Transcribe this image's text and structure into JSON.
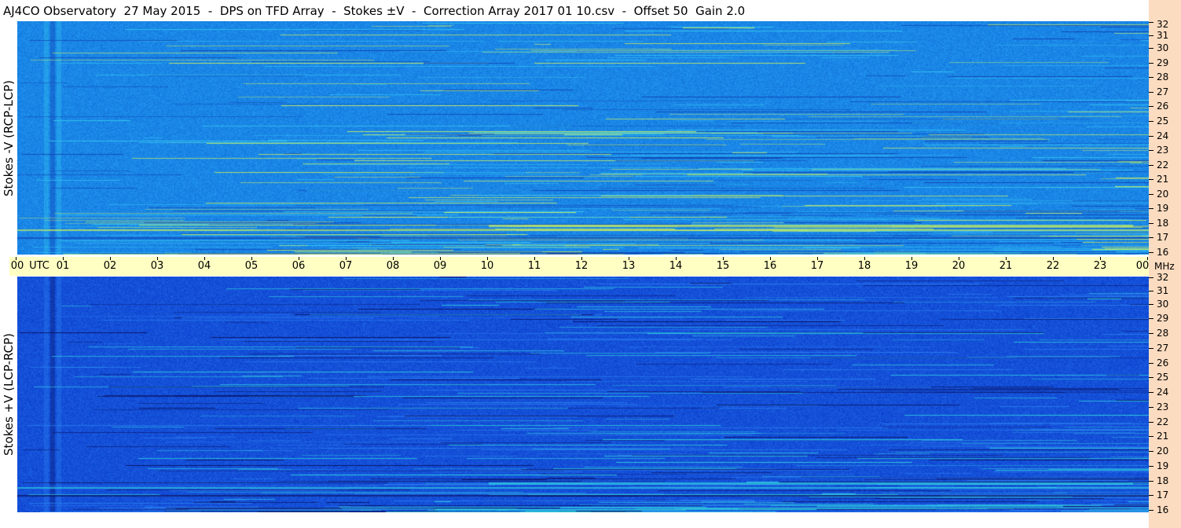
{
  "title": "AJ4CO Observatory  27 May 2015  -  DPS on TFD Array  -  Stokes ±V  -  Correction Array 2017 01 10.csv  -  Offset 50  Gain 2.0",
  "chart_data": [
    {
      "type": "heatmap",
      "panel": "top",
      "ylabel": "Stokes -V (RCP-LCP)",
      "base_color": "#1a86e6",
      "x_range": [
        0,
        24
      ],
      "y_range": [
        16,
        32
      ],
      "y_unit": "MHz"
    },
    {
      "type": "heatmap",
      "panel": "bottom",
      "ylabel": "Stokes +V (LCP-RCP)",
      "base_color": "#1450d8",
      "x_range": [
        0,
        24
      ],
      "y_range": [
        16,
        32
      ],
      "y_unit": "MHz"
    }
  ],
  "time_axis": {
    "ticks": [
      "00",
      "01",
      "02",
      "03",
      "04",
      "05",
      "06",
      "07",
      "08",
      "09",
      "10",
      "11",
      "12",
      "13",
      "14",
      "15",
      "16",
      "17",
      "18",
      "19",
      "20",
      "21",
      "22",
      "23",
      "00"
    ],
    "utc_label": "UTC",
    "unit_label": "MHz"
  },
  "freq_axis": {
    "ticks": [
      "16",
      "17",
      "18",
      "19",
      "20",
      "21",
      "22",
      "23",
      "24",
      "25",
      "26",
      "27",
      "28",
      "29",
      "30",
      "31",
      "32"
    ]
  }
}
